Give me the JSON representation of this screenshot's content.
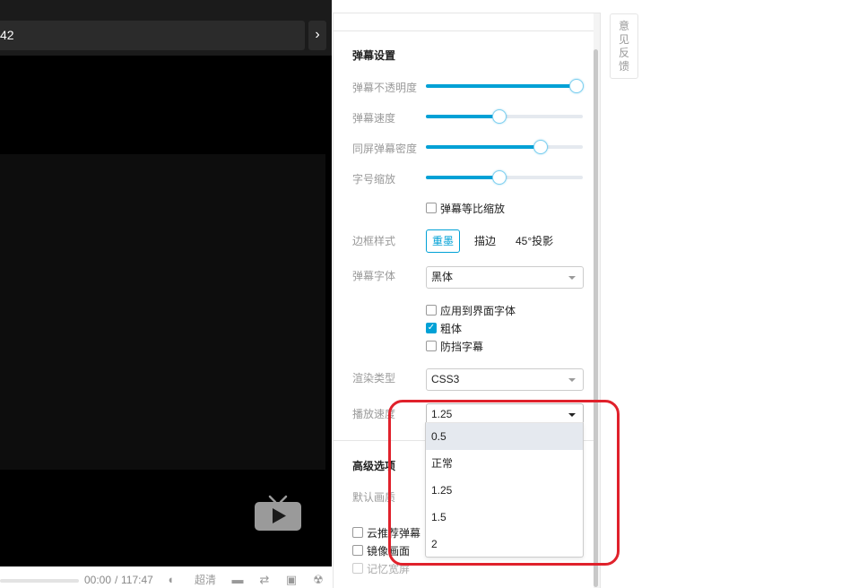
{
  "player": {
    "title_fragment": "42",
    "next_icon": "chevron-right-icon",
    "time_current": "00:00",
    "time_separator": "/",
    "time_total": "117:47",
    "quality_label": "超清"
  },
  "settings": {
    "danmaku_section_title": "弹幕设置",
    "opacity_label": "弹幕不透明度",
    "opacity_value": 0.96,
    "speed_label": "弹幕速度",
    "speed_value": 0.47,
    "density_label": "同屏弹幕密度",
    "density_value": 0.73,
    "fontscale_label": "字号缩放",
    "fontscale_value": 0.47,
    "proportional_scale_label": "弹幕等比缩放",
    "proportional_scale_checked": false,
    "border_style_label": "边框样式",
    "border_styles": [
      "重墨",
      "描边",
      "45°投影"
    ],
    "border_style_selected": "重墨",
    "font_label": "弹幕字体",
    "font_value": "黑体",
    "apply_ui_font_label": "应用到界面字体",
    "apply_ui_font_checked": false,
    "bold_label": "粗体",
    "bold_checked": true,
    "block_subtitle_label": "防挡字幕",
    "block_subtitle_checked": false,
    "render_type_label": "渲染类型",
    "render_type_value": "CSS3",
    "playback_speed_label": "播放速度",
    "playback_speed_value": "1.25",
    "playback_speed_options": [
      "0.5",
      "正常",
      "1.25",
      "1.5",
      "2"
    ],
    "playback_speed_highlight": "0.5",
    "advanced_section_title": "高级选项",
    "default_quality_label": "默认画质",
    "cloud_recommend_label": "云推荐弹幕",
    "mirror_label": "镜像画面",
    "remember_widescreen_label": "记忆宽屏"
  },
  "feedback": {
    "chars": [
      "意",
      "见",
      "反",
      "馈"
    ]
  },
  "colors": {
    "accent": "#00a1d6",
    "annotation": "#e0212b"
  }
}
